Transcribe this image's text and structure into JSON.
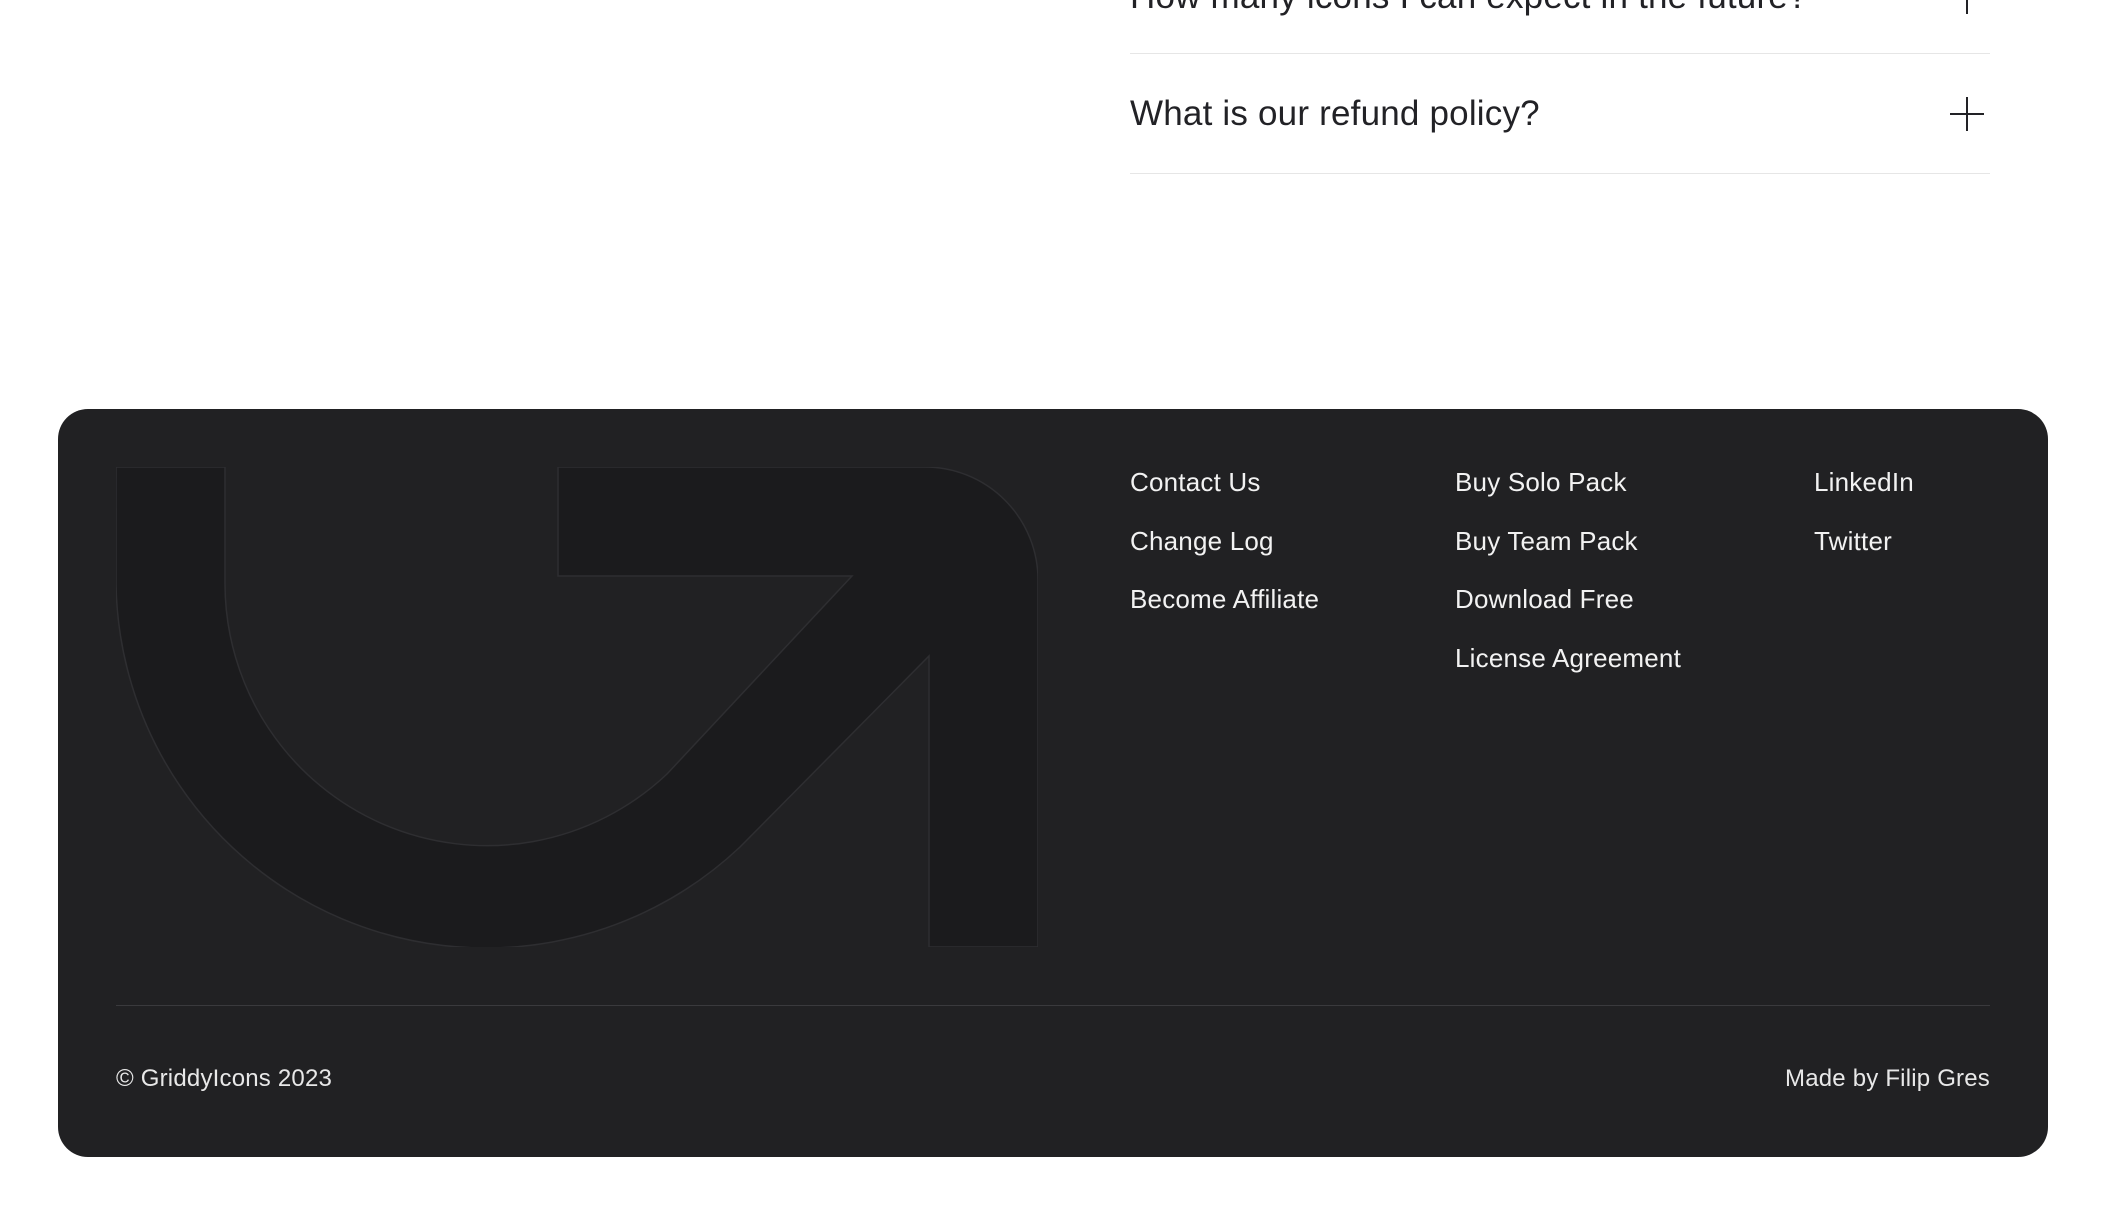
{
  "faq": {
    "items": [
      {
        "question": "How many icons I can expect in the future?"
      },
      {
        "question": "What is our refund policy?"
      }
    ]
  },
  "footer": {
    "logo_icon": "arrow-up-right-curve-icon",
    "columns": [
      {
        "links": [
          "Contact Us",
          "Change Log",
          "Become Affiliate"
        ]
      },
      {
        "links": [
          "Buy Solo Pack",
          "Buy Team Pack",
          "Download Free",
          "License Agreement"
        ]
      },
      {
        "links": [
          "LinkedIn",
          "Twitter"
        ]
      }
    ],
    "copyright": "© GriddyIcons 2023",
    "made_by": "Made by Filip Gres"
  },
  "colors": {
    "footer_bg": "#212123",
    "logo_fill": "#1b1b1d",
    "text_dark": "#222226",
    "text_light": "#f2f2f2"
  }
}
